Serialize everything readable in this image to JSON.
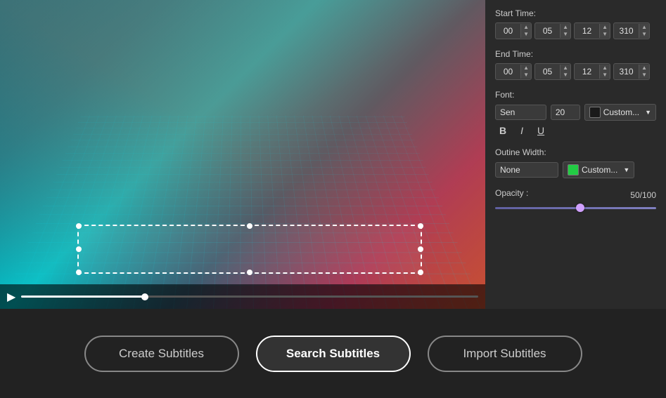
{
  "panel": {
    "start_time_label": "Start Time:",
    "end_time_label": "End Time:",
    "font_label": "Font:",
    "outline_width_label": "Outine Width:",
    "opacity_label": "Opacity :",
    "start_time": {
      "h": "00",
      "m": "05",
      "s": "12",
      "ms": "310"
    },
    "end_time": {
      "h": "00",
      "m": "05",
      "s": "12",
      "ms": "310"
    },
    "font_family": "Sen",
    "font_size": "20",
    "font_color": "Custom...",
    "bold_label": "B",
    "italic_label": "I",
    "underline_label": "U",
    "outline_none": "None",
    "outline_custom": "Custom...",
    "opacity_value": "50/100"
  },
  "buttons": {
    "create": "Create Subtitles",
    "search": "Search Subtitles",
    "import": "Import Subtitles"
  }
}
